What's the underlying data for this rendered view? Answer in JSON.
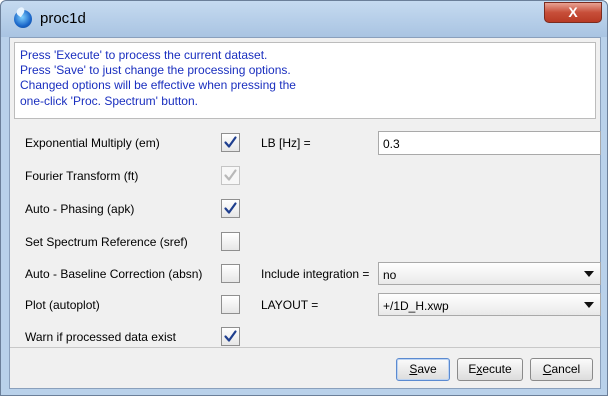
{
  "window": {
    "title": "proc1d",
    "close_glyph": "X"
  },
  "info": {
    "lines": [
      "Press 'Execute' to process the current dataset.",
      "Press 'Save' to just change the processing options.",
      "Changed options will be effective when pressing the",
      "one-click 'Proc. Spectrum' button."
    ]
  },
  "options": [
    {
      "label": "Exponential Multiply (em)",
      "checked": true,
      "enabled": true,
      "param_label": "LB [Hz] =",
      "param_value": "0.3"
    },
    {
      "label": "Fourier Transform (ft)",
      "checked": true,
      "enabled": false
    },
    {
      "label": "Auto - Phasing (apk)",
      "checked": true,
      "enabled": true
    },
    {
      "label": "Set Spectrum Reference (sref)",
      "checked": false,
      "enabled": true
    },
    {
      "label": "Auto - Baseline Correction (absn)",
      "checked": false,
      "enabled": true,
      "param_label": "Include integration =",
      "param_value": "no"
    },
    {
      "label": "Plot (autoplot)",
      "checked": false,
      "enabled": true,
      "param_label": "LAYOUT =",
      "param_value": "+/1D_H.xwp"
    },
    {
      "label": "Warn if processed data exist",
      "checked": true,
      "enabled": true
    }
  ],
  "buttons": {
    "save": {
      "mnemonic": "S",
      "rest": "ave"
    },
    "execute": {
      "first": "E",
      "mnemonic": "x",
      "rest": "ecute"
    },
    "cancel": {
      "mnemonic": "C",
      "rest": "ancel"
    }
  },
  "colors": {
    "info_text": "#1a2fbf",
    "title_bar": "#b9d1ea",
    "close_button": "#c74e39",
    "check_mark": "#1f3f8f"
  }
}
